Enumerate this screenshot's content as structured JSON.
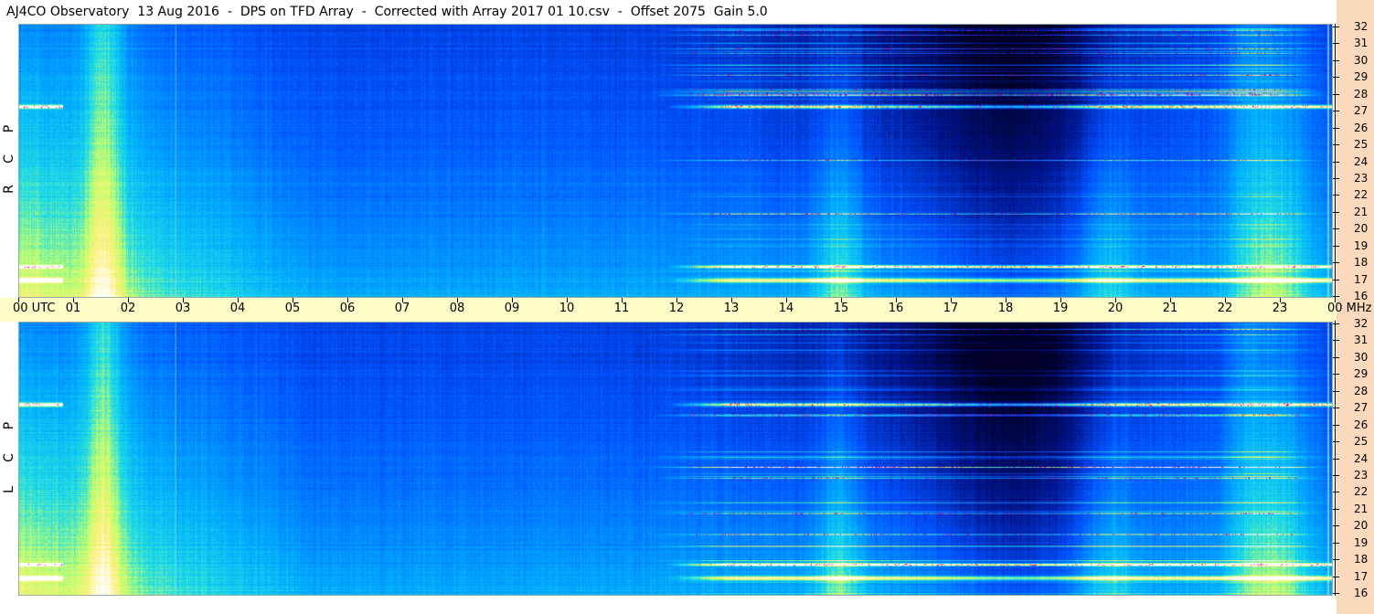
{
  "title": "AJ4CO Observatory  13 Aug 2016  -  DPS on TFD Array  -  Corrected with Array 2017 01 10.csv  -  Offset 2075  Gain 5.0",
  "chart_data": {
    "type": "heatmap",
    "panels": [
      {
        "name": "RCP",
        "letters": [
          "R",
          "C",
          "P"
        ]
      },
      {
        "name": "LCP",
        "letters": [
          "L",
          "C",
          "P"
        ]
      }
    ],
    "x_axis": {
      "tick_labels": [
        "00 UTC",
        "01",
        "02",
        "03",
        "04",
        "05",
        "06",
        "07",
        "08",
        "09",
        "10",
        "11",
        "12",
        "13",
        "14",
        "15",
        "16",
        "17",
        "18",
        "19",
        "20",
        "21",
        "22",
        "23",
        "00 MHz"
      ],
      "range_hours": [
        0,
        24
      ]
    },
    "y_axis": {
      "unit": "MHz",
      "tick_labels": [
        "32",
        "31",
        "30",
        "29",
        "28",
        "27",
        "26",
        "25",
        "24",
        "23",
        "22",
        "21",
        "20",
        "19",
        "18",
        "17",
        "16"
      ],
      "range_mhz": [
        16,
        32
      ]
    },
    "colors": {
      "low": "#000040",
      "mid_low": "#0050ff",
      "mid": "#00c8ff",
      "mid_high": "#c8ff64",
      "high": "#ffffff",
      "interference": "#ff00a0",
      "axis_band": "#fdfdc8",
      "right_band": "#fbd9bd"
    }
  }
}
